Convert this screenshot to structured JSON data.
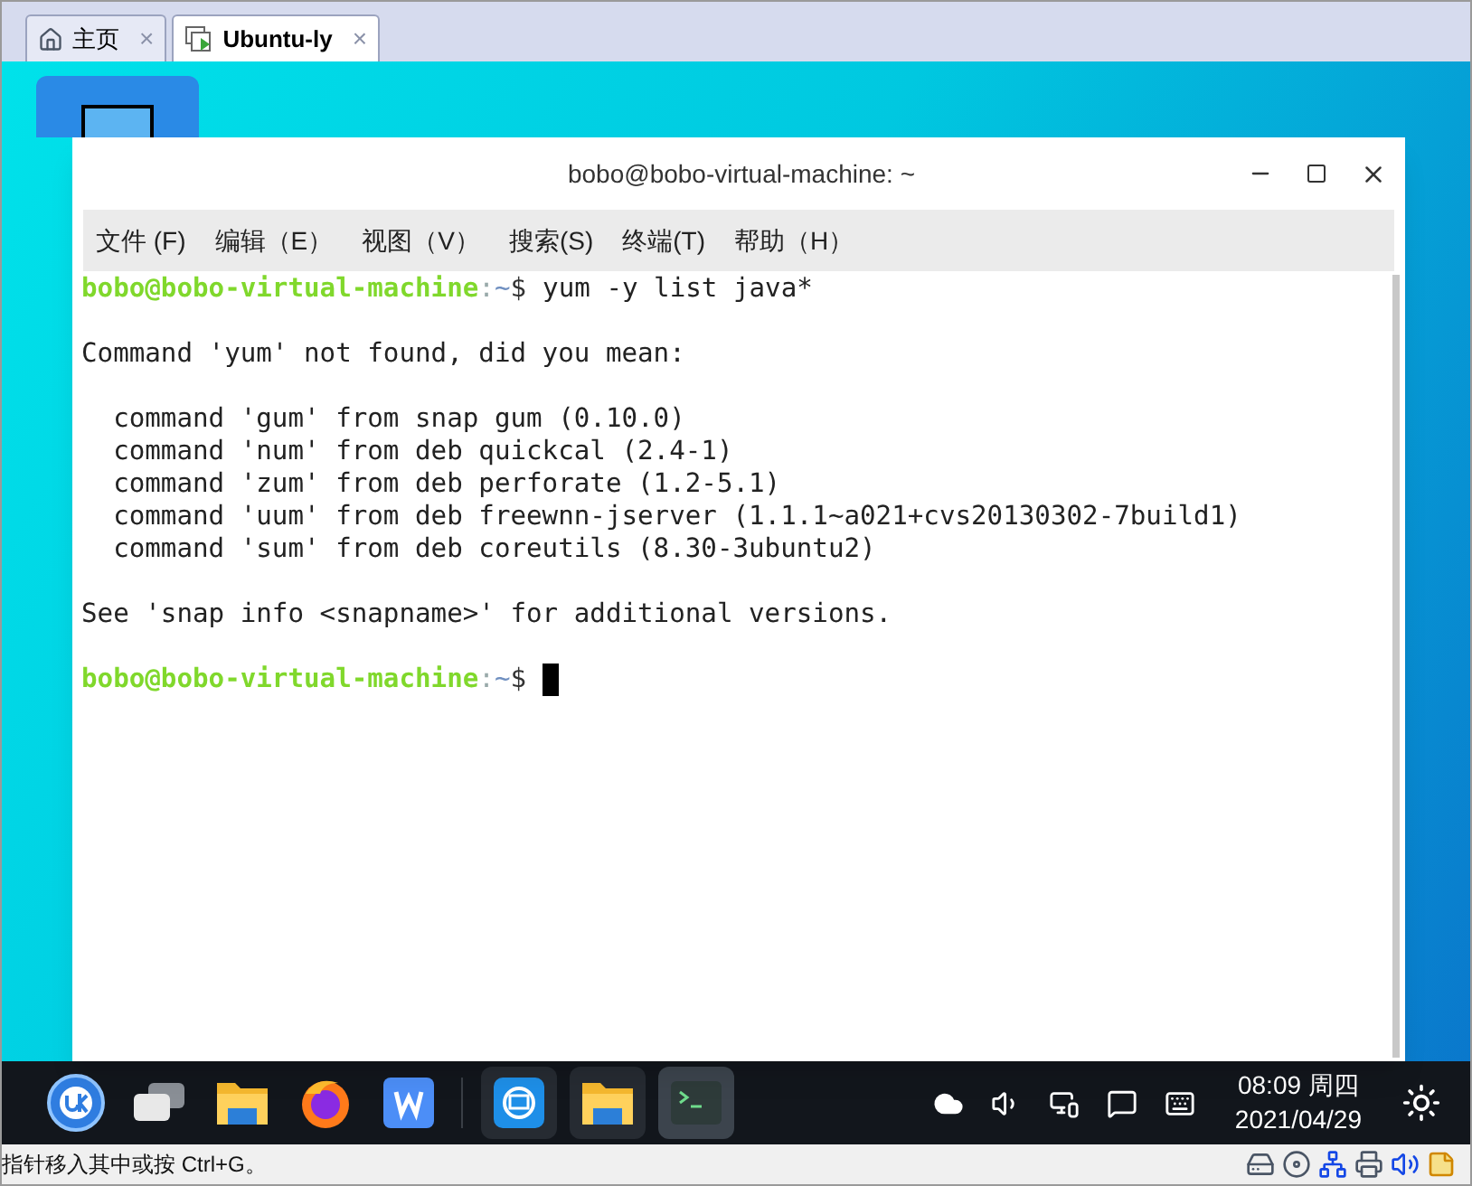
{
  "tabs": [
    {
      "label": "主页",
      "kind": "home",
      "selected": false,
      "close": "×"
    },
    {
      "label": "Ubuntu-ly",
      "kind": "vm",
      "selected": true,
      "close": "×"
    }
  ],
  "terminal": {
    "title": "bobo@bobo-virtual-machine: ~",
    "menu": [
      "文件 (F)",
      "编辑（E）",
      "视图（V）",
      "搜索(S)",
      "终端(T)",
      "帮助（H）"
    ],
    "lines": [
      {
        "kind": "prompt",
        "user_host": "bobo@bobo-virtual-machine",
        "separator": ":",
        "path": "~",
        "symbol": "$",
        "command": "yum -y list java*",
        "cursor": false
      },
      {
        "kind": "blank"
      },
      {
        "kind": "output",
        "text": "Command 'yum' not found, did you mean:"
      },
      {
        "kind": "blank"
      },
      {
        "kind": "output",
        "text": "  command 'gum' from snap gum (0.10.0)"
      },
      {
        "kind": "output",
        "text": "  command 'num' from deb quickcal (2.4-1)"
      },
      {
        "kind": "output",
        "text": "  command 'zum' from deb perforate (1.2-5.1)"
      },
      {
        "kind": "output",
        "text": "  command 'uum' from deb freewnn-jserver (1.1.1~a021+cvs20130302-7build1)"
      },
      {
        "kind": "output",
        "text": "  command 'sum' from deb coreutils (8.30-3ubuntu2)"
      },
      {
        "kind": "blank"
      },
      {
        "kind": "output",
        "text": "See 'snap info <snapname>' for additional versions."
      },
      {
        "kind": "blank"
      },
      {
        "kind": "prompt",
        "user_host": "bobo@bobo-virtual-machine",
        "separator": ":",
        "path": "~",
        "symbol": "$",
        "cursor": true
      }
    ]
  },
  "taskbar": {
    "launchers": [
      {
        "kind": "uk"
      },
      {
        "kind": "windows"
      },
      {
        "kind": "files"
      },
      {
        "kind": "firefox"
      },
      {
        "kind": "wps"
      }
    ],
    "running": [
      {
        "kind": "store",
        "selected": false
      },
      {
        "kind": "files",
        "selected": false
      },
      {
        "kind": "terminal",
        "selected": true
      }
    ],
    "tray": [
      {
        "kind": "cloud"
      },
      {
        "kind": "volume"
      },
      {
        "kind": "network"
      },
      {
        "kind": "chat"
      },
      {
        "kind": "keyboard"
      }
    ],
    "time": "08:09 周四",
    "date": "2021/04/29"
  },
  "status_bar": {
    "text": "指针移入其中或按 Ctrl+G。",
    "icons": [
      {
        "kind": "disk"
      },
      {
        "kind": "cd"
      },
      {
        "kind": "network"
      },
      {
        "kind": "printer"
      },
      {
        "kind": "sound"
      },
      {
        "kind": "note"
      }
    ]
  }
}
